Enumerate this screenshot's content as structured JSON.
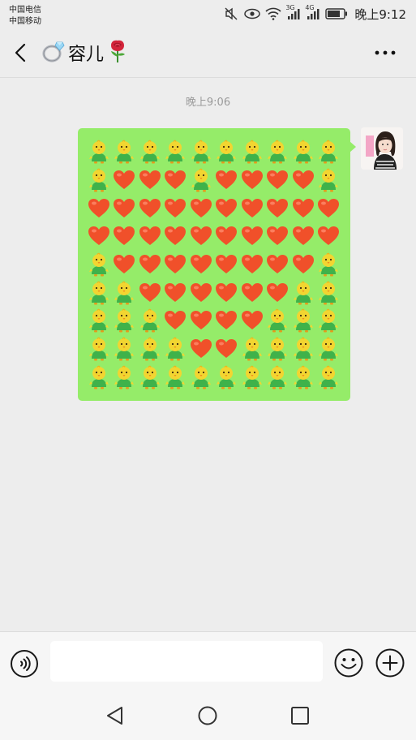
{
  "status_bar": {
    "carrier_1": "中国电信",
    "carrier_2": "中国移动",
    "network_1": "3G",
    "network_2": "4G",
    "time": "晚上9:12",
    "icons": [
      "mute-icon",
      "eye-icon",
      "wifi-icon",
      "signal-icon",
      "signal-icon",
      "battery-icon"
    ]
  },
  "header": {
    "title": "容儿",
    "title_prefix_icon": "ring-icon",
    "title_suffix_icon": "rose-icon",
    "back_icon": "back-arrow-icon",
    "more_icon": "more-icon"
  },
  "messages": {
    "timestamp": "晚上9:06",
    "bubble": {
      "sender": "self",
      "grid_legend": {
        "C": "chick-emoji",
        "H": "heart-emoji"
      },
      "rows": [
        "CCCCCCCCCC",
        "CHHHCHHHHC",
        "HHHHHHHHHH",
        "HHHHHHHHHH",
        "CHHHHHHHHC",
        "CCHHHHHHCC",
        "CCCHHHHCCC",
        "CCCCHHCCCC",
        "CCCCCCCCCC"
      ]
    }
  },
  "input_bar": {
    "voice_icon": "voice-icon",
    "input_value": "",
    "emoji_icon": "emoji-icon",
    "plus_icon": "plus-icon"
  },
  "nav_bar": {
    "back_icon": "nav-back-icon",
    "home_icon": "nav-home-icon",
    "recent_icon": "nav-recent-icon"
  },
  "colors": {
    "background": "#ededed",
    "bubble": "#95ec69",
    "heart": "#f0502a",
    "chick_body": "#f2d531",
    "chick_shirt": "#3fb24a"
  }
}
